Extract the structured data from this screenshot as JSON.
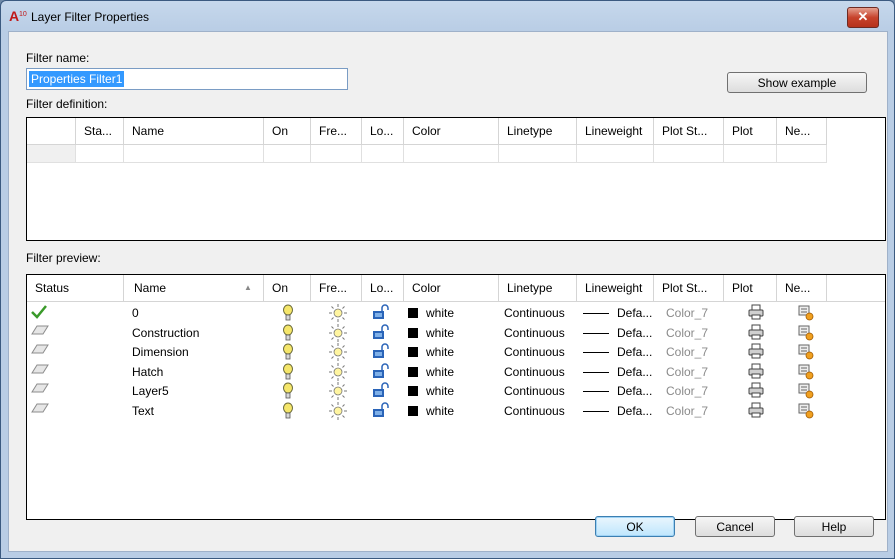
{
  "window": {
    "title": "Layer Filter Properties",
    "close_symbol": "✕"
  },
  "filter_name": {
    "label": "Filter name:",
    "value": "Properties Filter1"
  },
  "show_example_label": "Show example",
  "filter_definition": {
    "label": "Filter definition:",
    "columns": [
      "Sta...",
      "Name",
      "On",
      "Fre...",
      "Lo...",
      "Color",
      "Linetype",
      "Lineweight",
      "Plot St...",
      "Plot",
      "Ne..."
    ]
  },
  "filter_preview": {
    "label": "Filter preview:",
    "columns": [
      "Status",
      "Name",
      "On",
      "Fre...",
      "Lo...",
      "Color",
      "Linetype",
      "Lineweight",
      "Plot St...",
      "Plot",
      "Ne..."
    ],
    "sort_indicator": "▲",
    "rows": [
      {
        "status": "current-layer-check-icon",
        "name": "0",
        "color": "white",
        "linetype": "Continuous",
        "lineweight": "Defa...",
        "plot_style": "Color_7"
      },
      {
        "status": "layer-icon",
        "name": "Construction",
        "color": "white",
        "linetype": "Continuous",
        "lineweight": "Defa...",
        "plot_style": "Color_7"
      },
      {
        "status": "layer-icon",
        "name": "Dimension",
        "color": "white",
        "linetype": "Continuous",
        "lineweight": "Defa...",
        "plot_style": "Color_7"
      },
      {
        "status": "layer-icon",
        "name": "Hatch",
        "color": "white",
        "linetype": "Continuous",
        "lineweight": "Defa...",
        "plot_style": "Color_7"
      },
      {
        "status": "layer-icon",
        "name": "Layer5",
        "color": "white",
        "linetype": "Continuous",
        "lineweight": "Defa...",
        "plot_style": "Color_7"
      },
      {
        "status": "layer-icon",
        "name": "Text",
        "color": "white",
        "linetype": "Continuous",
        "lineweight": "Defa...",
        "plot_style": "Color_7"
      }
    ]
  },
  "buttons": {
    "ok": "OK",
    "cancel": "Cancel",
    "help": "Help"
  },
  "colors": {
    "selection": "#3399ff",
    "check": "#3a9a2a",
    "bulb": "#f5e66a",
    "lock": "#2a64b8",
    "newvp": "#f0a020"
  }
}
